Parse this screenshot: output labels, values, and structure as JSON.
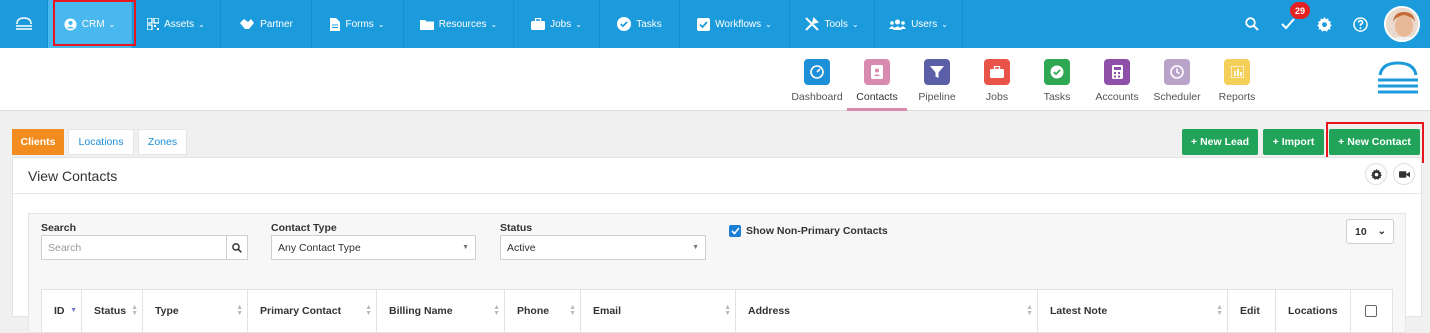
{
  "nav": {
    "items": [
      {
        "label": "CRM",
        "icon": "user-circle-icon",
        "has_chevron": true
      },
      {
        "label": "Assets",
        "icon": "qr-code-icon",
        "has_chevron": true
      },
      {
        "label": "Partner",
        "icon": "handshake-icon",
        "has_chevron": false
      },
      {
        "label": "Forms",
        "icon": "file-icon",
        "has_chevron": true
      },
      {
        "label": "Resources",
        "icon": "folder-icon",
        "has_chevron": true
      },
      {
        "label": "Jobs",
        "icon": "briefcase-icon",
        "has_chevron": true
      },
      {
        "label": "Tasks",
        "icon": "check-circle-icon",
        "has_chevron": false
      },
      {
        "label": "Workflows",
        "icon": "check-square-icon",
        "has_chevron": true
      },
      {
        "label": "Tools",
        "icon": "tools-icon",
        "has_chevron": true
      },
      {
        "label": "Users",
        "icon": "users-icon",
        "has_chevron": true
      }
    ],
    "notification_count": "29",
    "chevron": "⌄"
  },
  "modules": [
    {
      "label": "Dashboard",
      "color": "#1e90d8",
      "icon": "gauge-icon"
    },
    {
      "label": "Contacts",
      "color": "#d98ab0",
      "icon": "address-book-icon"
    },
    {
      "label": "Pipeline",
      "color": "#5a5fa8",
      "icon": "funnel-icon"
    },
    {
      "label": "Jobs",
      "color": "#e8534a",
      "icon": "briefcase-icon"
    },
    {
      "label": "Tasks",
      "color": "#2ea852",
      "icon": "check-circle-icon"
    },
    {
      "label": "Accounts",
      "color": "#8e4fa8",
      "icon": "calculator-icon"
    },
    {
      "label": "Scheduler",
      "color": "#b9a3c8",
      "icon": "clock-icon"
    },
    {
      "label": "Reports",
      "color": "#f4cf5a",
      "icon": "bar-chart-icon"
    }
  ],
  "tabs": [
    "Clients",
    "Locations",
    "Zones"
  ],
  "actions": {
    "new_lead": "New Lead",
    "import": "Import",
    "new_contact": "New Contact"
  },
  "panel": {
    "title": "View Contacts"
  },
  "filters": {
    "search_label": "Search",
    "search_placeholder": "Search",
    "contact_type_label": "Contact Type",
    "contact_type_value": "Any Contact Type",
    "status_label": "Status",
    "status_value": "Active",
    "show_non_primary_label": "Show Non-Primary Contacts",
    "show_non_primary_checked": true,
    "page_size": "10"
  },
  "table": {
    "columns": [
      "ID",
      "Status",
      "Type",
      "Primary Contact",
      "Billing Name",
      "Phone",
      "Email",
      "Address",
      "Latest Note",
      "Edit",
      "Locations"
    ]
  },
  "colors": {
    "nav_bg": "#1b9bdb",
    "nav_active": "#48b8ee",
    "green": "#22a35a",
    "orange": "#f28c1e",
    "highlight_red": "#e8161c"
  }
}
